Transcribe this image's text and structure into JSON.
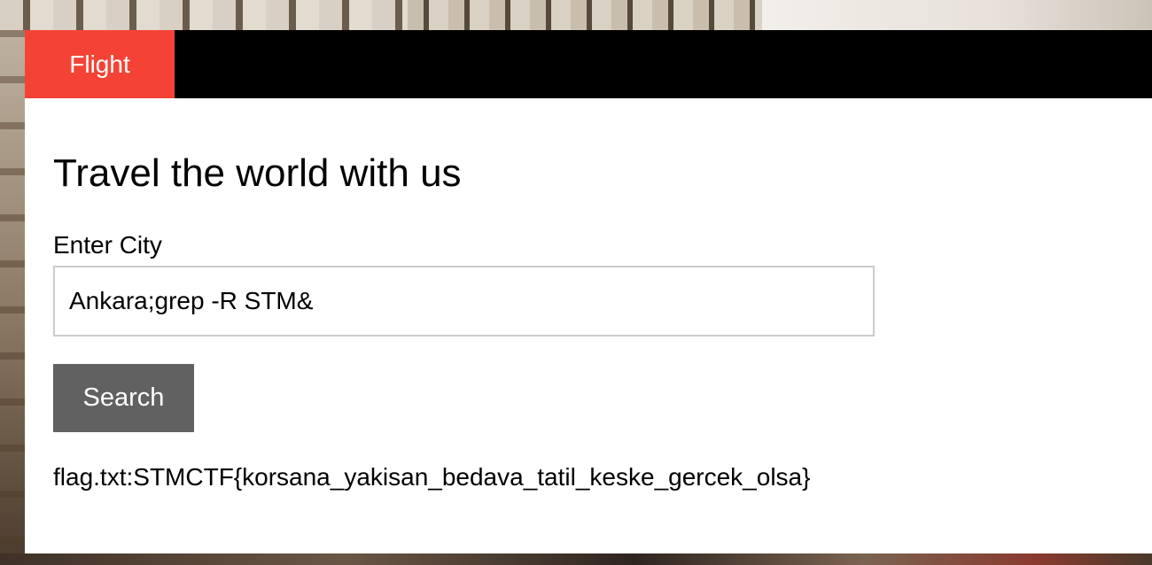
{
  "tabs": [
    {
      "label": "Flight"
    }
  ],
  "main": {
    "heading": "Travel the world with us",
    "city_label": "Enter City",
    "city_value": "Ankara;grep -R STM&",
    "search_label": "Search",
    "result_text": "flag.txt:STMCTF{korsana_yakisan_bedava_tatil_keske_gercek_olsa}"
  },
  "colors": {
    "tab_active": "#f44336",
    "tab_bar": "#000000",
    "button": "#616161",
    "input_border": "#cccccc"
  }
}
